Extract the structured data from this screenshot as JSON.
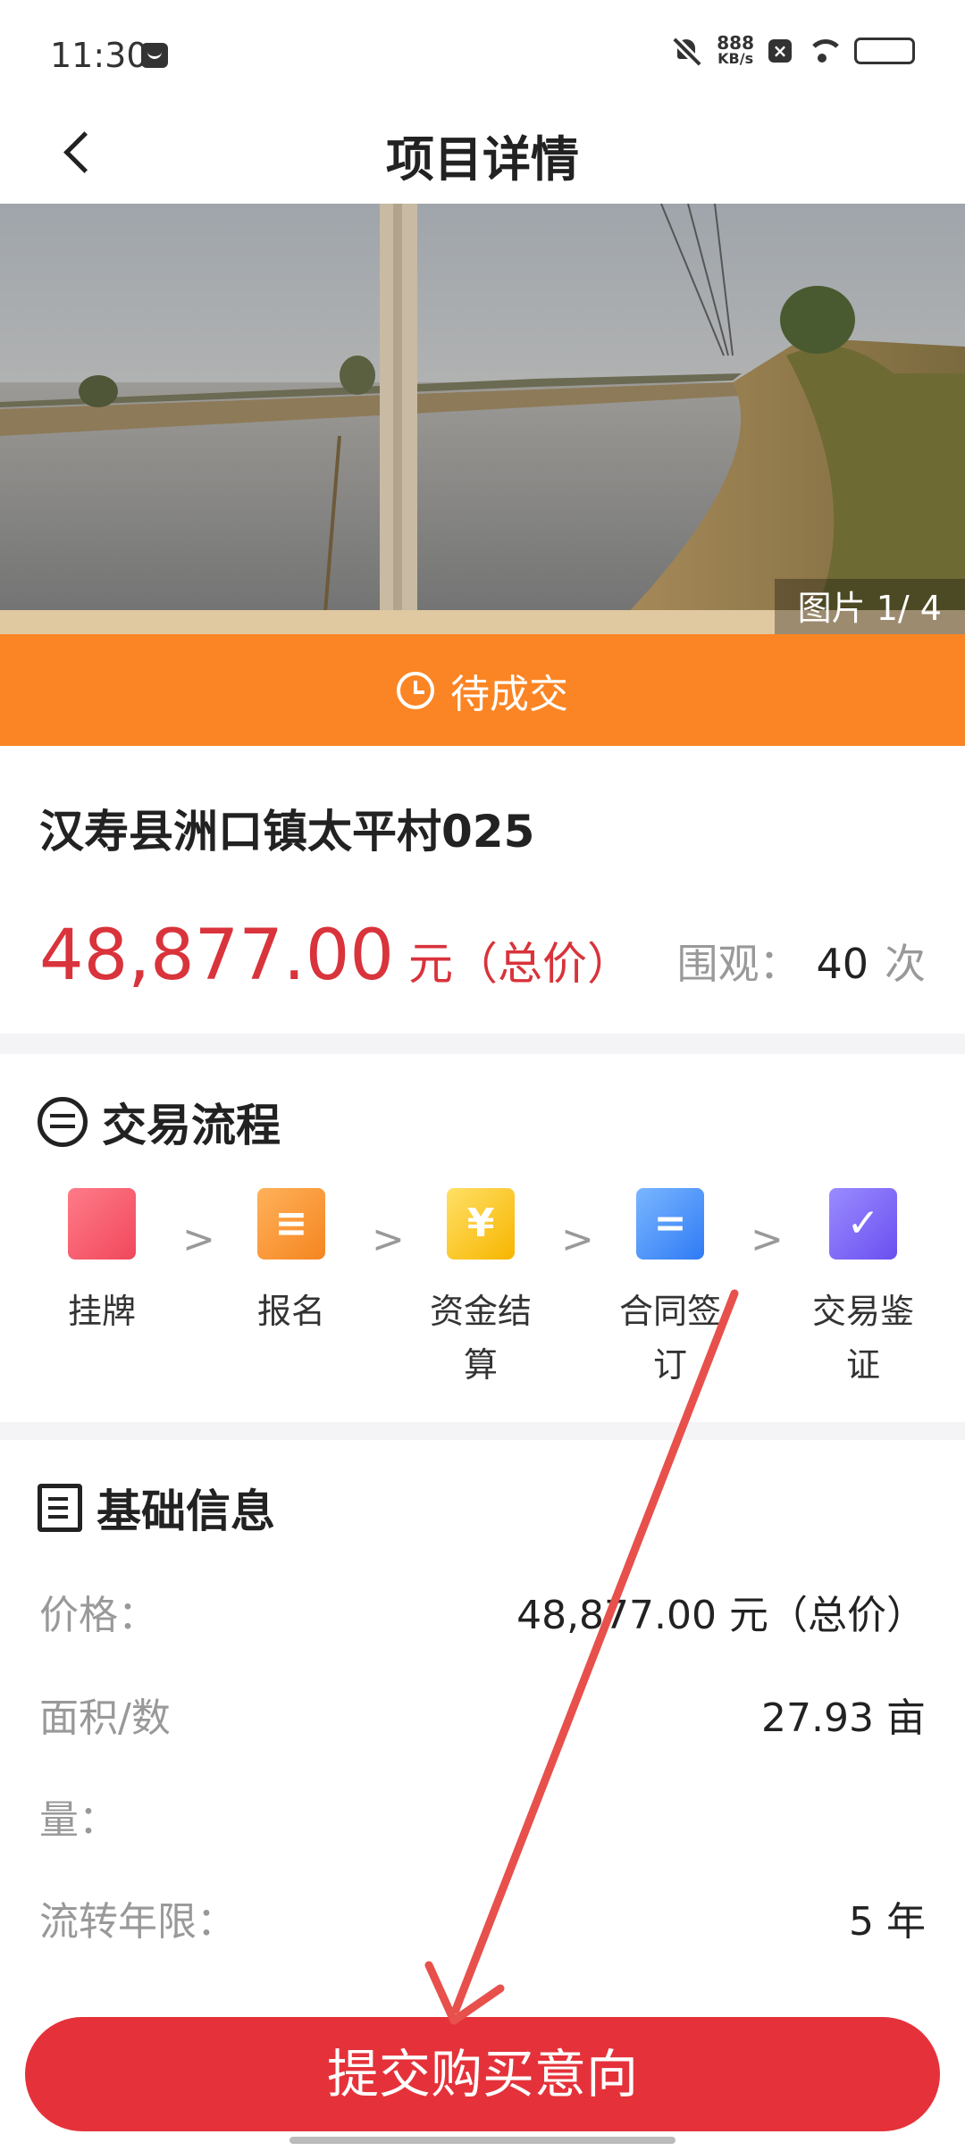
{
  "status_bar": {
    "time": "11:30",
    "net_speed_value": "888",
    "net_speed_unit": "KB/s",
    "icons": [
      "message-icon",
      "bell-off-icon",
      "close-box-icon",
      "wifi-icon",
      "battery-icon"
    ]
  },
  "nav": {
    "title": "项目详情",
    "back_icon": "chevron-left-icon"
  },
  "gallery": {
    "counter": "图片 1/ 4"
  },
  "status_strip": {
    "label": "待成交",
    "icon": "clock-icon",
    "color": "#fb8524"
  },
  "project": {
    "name": "汉寿县洲口镇太平村025",
    "price": "48,877.00",
    "price_unit": "元（总价）",
    "views_label": "围观：",
    "views_count": "40",
    "views_unit": "次",
    "price_color": "#d9333b"
  },
  "flow": {
    "title": "交易流程",
    "icon": "swap-icon",
    "steps": [
      {
        "label_line1": "挂牌",
        "label_line2": "",
        "icon": "bookmark-icon",
        "glyph": ""
      },
      {
        "label_line1": "报名",
        "label_line2": "",
        "icon": "clipboard-pen-icon",
        "glyph": "≡"
      },
      {
        "label_line1": "资金结",
        "label_line2": "算",
        "icon": "yen-icon",
        "glyph": "¥"
      },
      {
        "label_line1": "合同签",
        "label_line2": "订",
        "icon": "document-icon",
        "glyph": "="
      },
      {
        "label_line1": "交易鉴",
        "label_line2": "证",
        "icon": "check-box-icon",
        "glyph": "✓"
      }
    ]
  },
  "info": {
    "title": "基础信息",
    "icon": "edit-list-icon",
    "rows": [
      {
        "label": "价格：",
        "label_line2": "",
        "value": "48,877.00 元（总价）"
      },
      {
        "label": "面积/数",
        "label_line2": "量：",
        "value": "27.93 亩"
      },
      {
        "label": "流转年限：",
        "label_line2": "",
        "value": "5 年"
      }
    ]
  },
  "action": {
    "submit_label": "提交购买意向",
    "color": "#e5323a"
  }
}
